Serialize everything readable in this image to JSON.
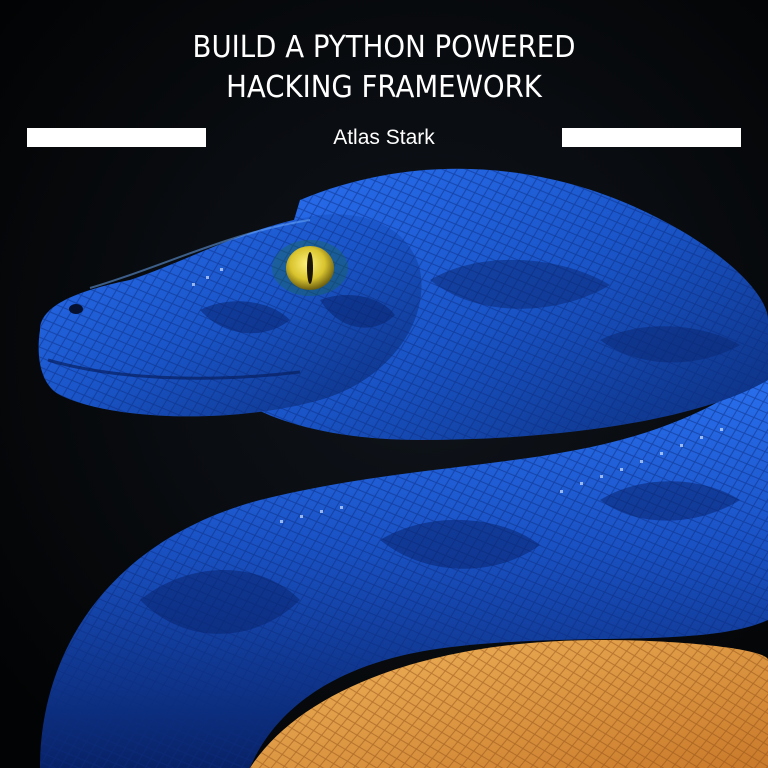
{
  "cover": {
    "title_line1": "BUILD A PYTHON POWERED",
    "title_line2": "HACKING FRAMEWORK",
    "author": "Atlas Stark"
  },
  "colors": {
    "background": "#050608",
    "snake_blue": "#1d5fd6",
    "snake_dark_blue": "#0a2a78",
    "eye_yellow": "#e2d43a",
    "lower_coil_orange": "#e8a24a",
    "text": "#ffffff"
  }
}
